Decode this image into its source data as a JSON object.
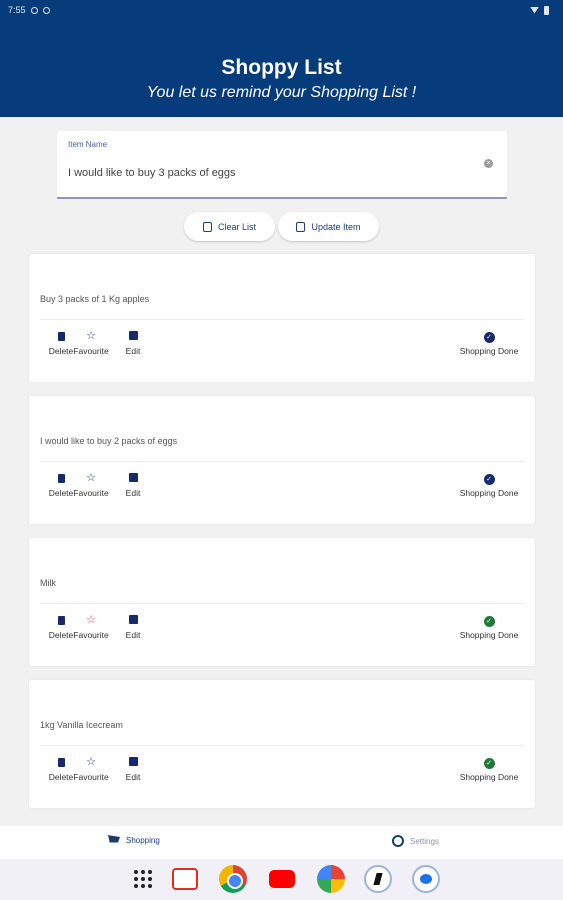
{
  "statusbar": {
    "time": "7:55"
  },
  "header": {
    "title": "Shoppy List",
    "subtitle": "You let us remind your Shopping List !"
  },
  "input": {
    "label": "Item Name",
    "value": "I would like to buy 3 packs of eggs"
  },
  "buttons": {
    "clear_label": "Clear List",
    "update_label": "Update Item"
  },
  "items": [
    {
      "text": "Buy 3 packs of 1 Kg apples",
      "favourite": false,
      "done_color": "#152a6e"
    },
    {
      "text": "I would like to buy 2 packs of eggs",
      "favourite": false,
      "done_color": "#152a6e"
    },
    {
      "text": "Milk",
      "favourite": true,
      "fav_color": "#d32f2f",
      "done_color": "#1e7a34"
    },
    {
      "text": "1kg Vanilla Icecream",
      "favourite": false,
      "done_color": "#1e7a34"
    }
  ],
  "actions": {
    "delete": "Delete",
    "favourite": "Favourite",
    "edit": "Edit",
    "done": "Shopping Done"
  },
  "nav": {
    "shopping": "Shopping",
    "settings": "Settings",
    "active_color": "#1a3a8c",
    "inactive_color": "#8a93a8"
  },
  "colors": {
    "header_bg": "#063c7c",
    "accent": "#152a6e"
  }
}
